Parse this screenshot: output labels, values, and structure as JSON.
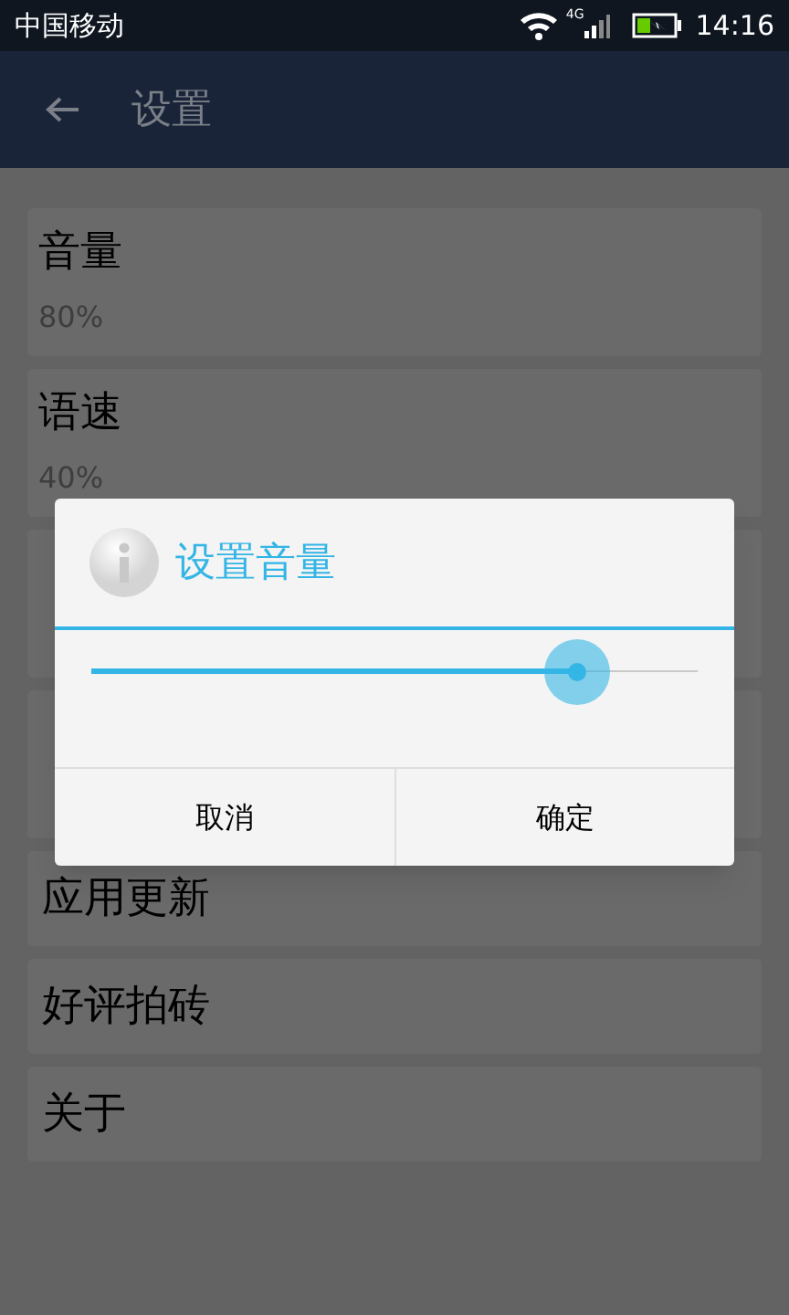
{
  "status_bar": {
    "carrier": "中国移动",
    "network": "4G",
    "time": "14:16"
  },
  "toolbar": {
    "title": "设置"
  },
  "settings": [
    {
      "kind": "two_line",
      "title": "音量",
      "value": "80%"
    },
    {
      "kind": "two_line",
      "title": "语速",
      "value": "40%"
    },
    {
      "kind": "two_line"
    },
    {
      "kind": "two_line"
    },
    {
      "kind": "one_line",
      "title": "应用更新"
    },
    {
      "kind": "one_line",
      "title": "好评拍砖"
    },
    {
      "kind": "one_line",
      "title": "关于"
    }
  ],
  "dialog": {
    "title": "设置音量",
    "slider": {
      "level": 0.8
    },
    "buttons": [
      "取消",
      "确定"
    ]
  }
}
